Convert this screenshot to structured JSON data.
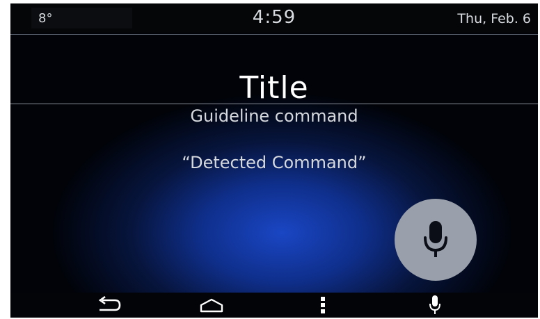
{
  "status": {
    "temperature": "8°",
    "time": "4:59",
    "date": "Thu, Feb. 6"
  },
  "main": {
    "title": "Title",
    "guideline": "Guideline command",
    "detected": "“Detected Command”"
  },
  "mic": {
    "icon": "microphone-icon"
  },
  "nav": {
    "items": [
      {
        "icon": "back-icon"
      },
      {
        "icon": "home-icon"
      },
      {
        "icon": "menu-dots-icon"
      },
      {
        "icon": "microphone-icon"
      }
    ]
  },
  "colors": {
    "background_dark": "#010309",
    "glow_blue": "#1a46c4",
    "text": "#d6d9de",
    "mic_button": "#9aa0ab"
  }
}
